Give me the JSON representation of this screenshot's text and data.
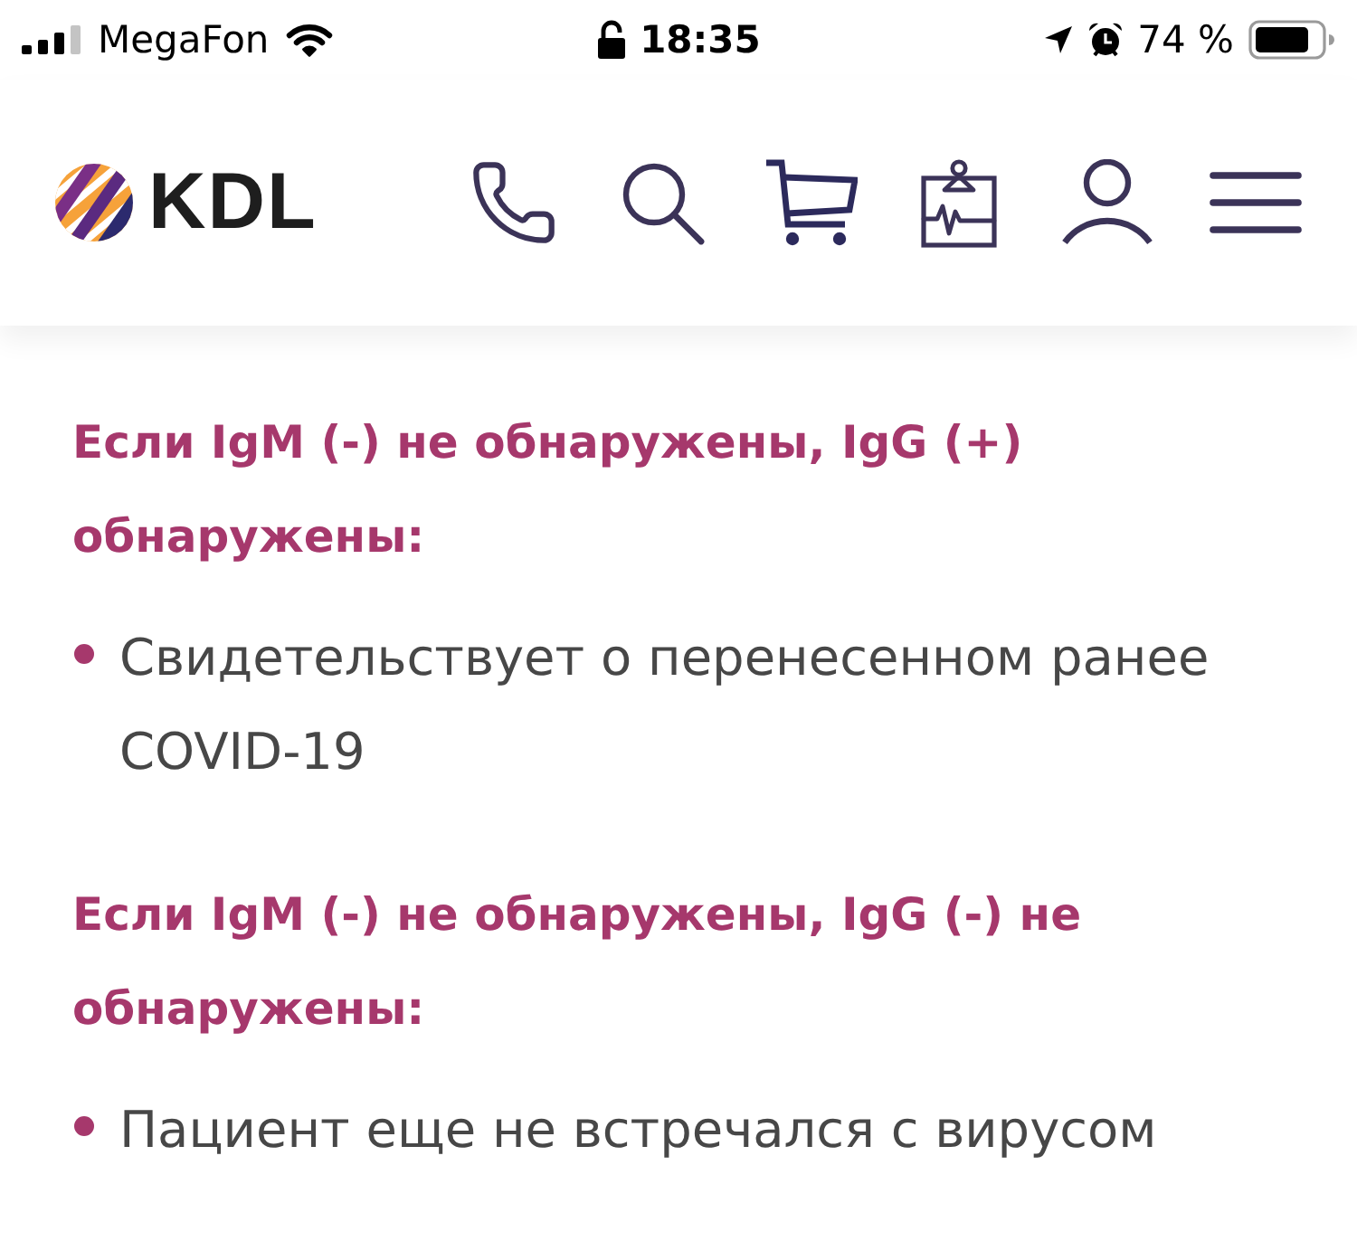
{
  "status_bar": {
    "carrier": "MegaFon",
    "time": "18:35",
    "battery": "74 %"
  },
  "header": {
    "logo": "KDL"
  },
  "sections": [
    {
      "heading": "Если IgM (-) не обнаружены, IgG (+) обнаружены:",
      "items": [
        "Свидетельствует о перенесенном ранее COVID-19"
      ]
    },
    {
      "heading": "Если IgM (-) не обнаружены, IgG (-) не обнаружены:",
      "items": [
        "Пациент еще не встречался с вирусом"
      ]
    }
  ]
}
